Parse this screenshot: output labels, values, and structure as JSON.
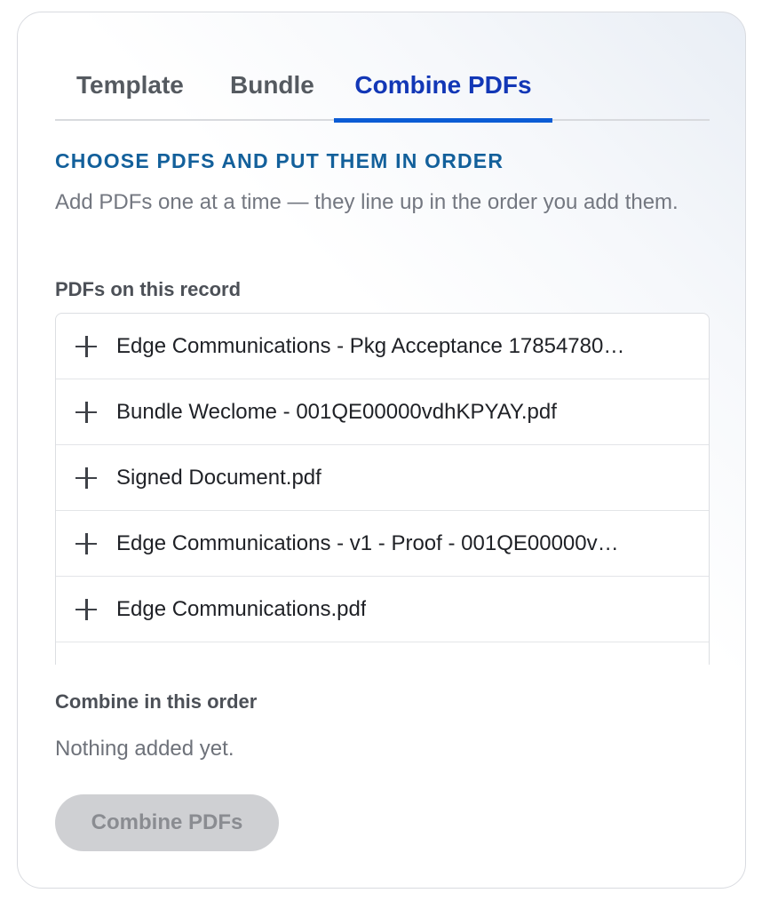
{
  "tabs": [
    {
      "label": "Template",
      "active": false
    },
    {
      "label": "Bundle",
      "active": false
    },
    {
      "label": "Combine PDFs",
      "active": true
    }
  ],
  "section": {
    "heading": "CHOOSE PDFS AND PUT THEM IN ORDER",
    "helper": "Add PDFs one at a time — they line up in the order you add them."
  },
  "pdf_list": {
    "label": "PDFs on this record",
    "items": [
      {
        "icon": "plus-icon",
        "name": "Edge Communications - Pkg Acceptance 17854780…"
      },
      {
        "icon": "plus-icon",
        "name": "Bundle Weclome - 001QE00000vdhKPYAY.pdf"
      },
      {
        "icon": "plus-icon",
        "name": "Signed Document.pdf"
      },
      {
        "icon": "plus-icon",
        "name": "Edge Communications - v1 - Proof - 001QE00000v…"
      },
      {
        "icon": "plus-icon",
        "name": "Edge Communications.pdf"
      }
    ]
  },
  "order": {
    "label": "Combine in this order",
    "empty_text": "Nothing added yet."
  },
  "actions": {
    "combine_label": "Combine PDFs",
    "combine_disabled": true
  },
  "colors": {
    "accent": "#0b5cd5",
    "active_tab_text": "#1237b6",
    "heading": "#13609b",
    "disabled_button": "#cfd0d3"
  }
}
